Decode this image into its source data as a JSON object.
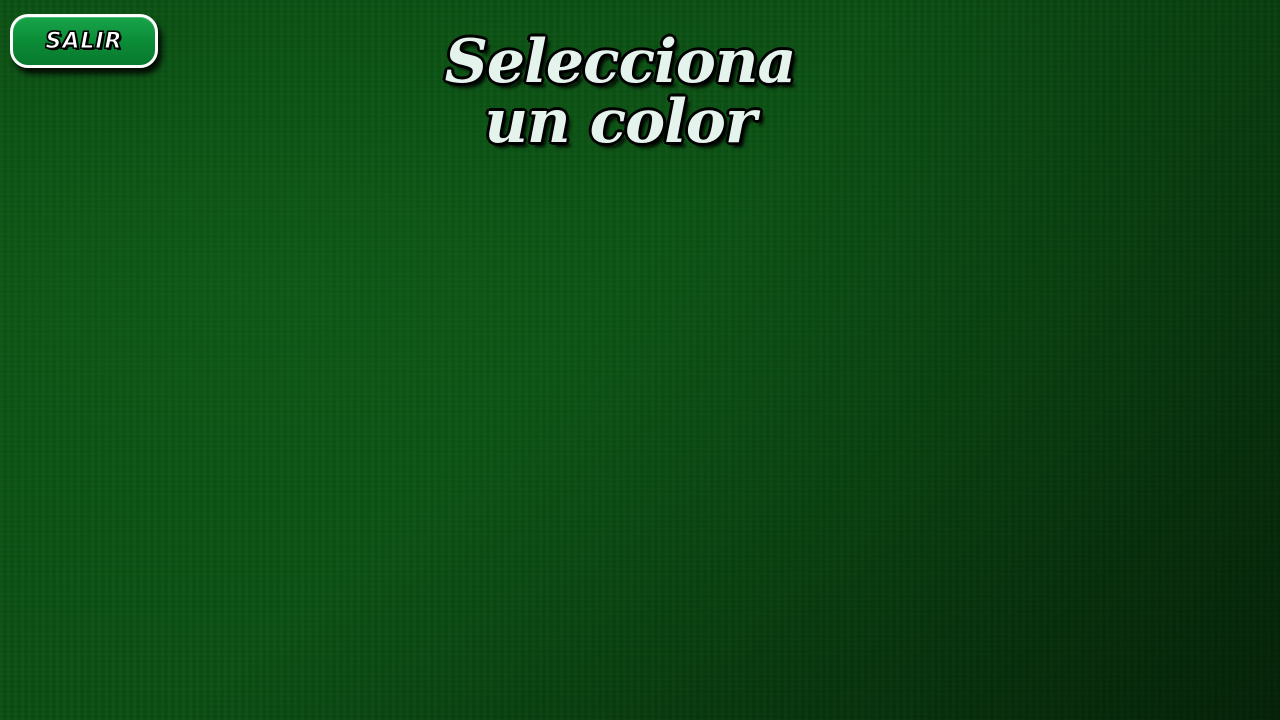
{
  "header": {
    "exit_label": "SALIR"
  },
  "title": {
    "line1": "Selecciona",
    "line2": "un color"
  },
  "colors": {
    "background": "#0a4d12",
    "button": "#0b8a36",
    "button_border": "#ffffff",
    "title_text": "#e4f3ec"
  }
}
